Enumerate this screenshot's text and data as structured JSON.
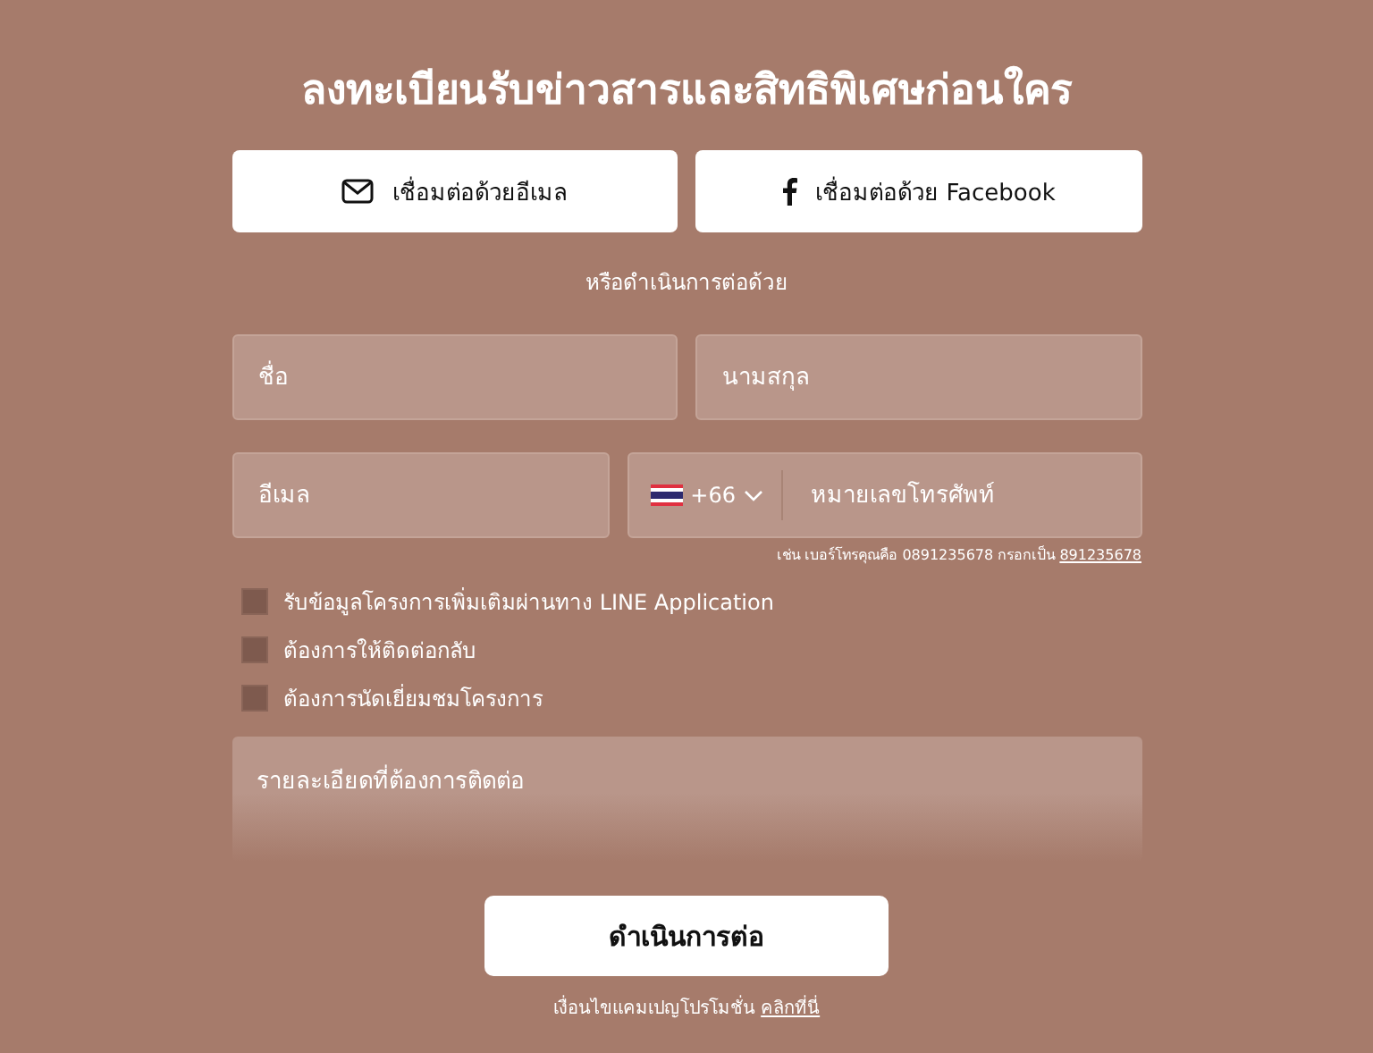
{
  "title": "ลงทะเบียนรับข่าวสารและสิทธิพิเศษก่อนใคร",
  "social_buttons": [
    {
      "kind": "email",
      "label": "เชื่อมต่อด้วยอีเมล"
    },
    {
      "kind": "facebook",
      "label": "เชื่อมต่อด้วย Facebook"
    }
  ],
  "divider_text": "หรือดำเนินการต่อด้วย",
  "first_name": {
    "placeholder": "ชื่อ"
  },
  "last_name": {
    "placeholder": "นามสกุล"
  },
  "email": {
    "placeholder": "อีเมล"
  },
  "phone": {
    "country_code": "+66",
    "placeholder": "หมายเลขโทรศัพท์"
  },
  "phone_hint": {
    "text": "เช่น เบอร์โทรคุณคือ 0891235678 กรอกเป็น",
    "example": "891235678"
  },
  "checkboxes": [
    {
      "label": "รับข้อมูลโครงการเพิ่มเติมผ่านทาง LINE Application",
      "checked": false
    },
    {
      "label": "ต้องการให้ติดต่อกลับ",
      "checked": false
    },
    {
      "label": "ต้องการนัดเยี่ยมชมโครงการ",
      "checked": false
    }
  ],
  "details": {
    "placeholder": "รายละเอียดที่ต้องการติดต่อ"
  },
  "submit": "ดำเนินการต่อ",
  "terms": {
    "text": "เงื่อนไขแคมเปญโปรโมชั่น",
    "link": "คลิกที่นี่"
  }
}
